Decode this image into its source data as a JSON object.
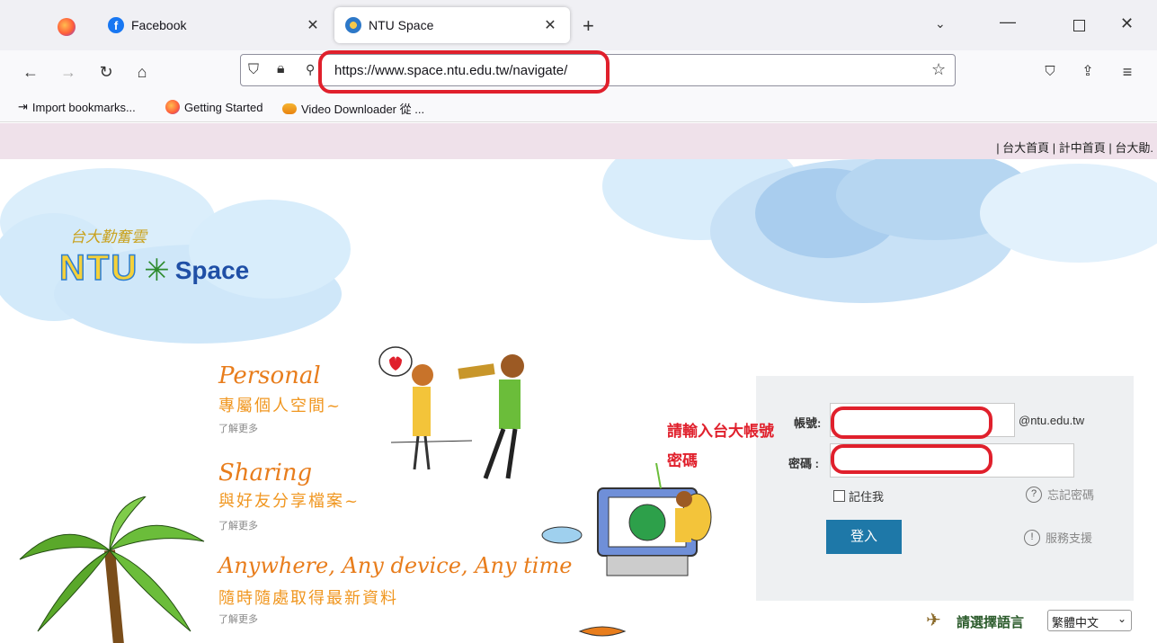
{
  "browser": {
    "tabs": [
      {
        "title": "Facebook",
        "close": "✕"
      },
      {
        "title": "NTU Space",
        "close": "✕"
      }
    ],
    "new_tab": "+",
    "url": "https://www.space.ntu.edu.tw/navigate/",
    "bookmarks": [
      "Import bookmarks...",
      "Getting Started",
      "Video Downloader 從 ..."
    ]
  },
  "page": {
    "top_links": "| 台大首頁 | 計中首頁 | 台大勛.",
    "logo": {
      "tagline": "台大勤奮雲",
      "ntu": "NTU",
      "space": "Space"
    },
    "features": [
      {
        "title": "Personal",
        "subtitle": "專屬個人空間~",
        "more": "了解更多"
      },
      {
        "title": "Sharing",
        "subtitle": "與好友分享檔案~",
        "more": "了解更多"
      },
      {
        "title": "Anywhere, Any device, Any time",
        "subtitle": "隨時隨處取得最新資料",
        "more": "了解更多"
      }
    ],
    "login": {
      "account_label": "帳號:",
      "account_suffix": "@ntu.edu.tw",
      "password_label": "密碼 :",
      "remember_label": "記住我",
      "forgot_label": "忘記密碼",
      "submit_label": "登入",
      "support_label": "服務支援"
    },
    "annotations": {
      "account_hint": "請輸入台大帳號",
      "password_hint": "密碼"
    },
    "language": {
      "label": "請選擇語言",
      "selected": "繁體中文"
    }
  },
  "colors": {
    "accent_red": "#e0202c",
    "login_button": "#1e78a8",
    "feature_orange": "#e87d1c",
    "top_strip": "#efe1ea"
  }
}
